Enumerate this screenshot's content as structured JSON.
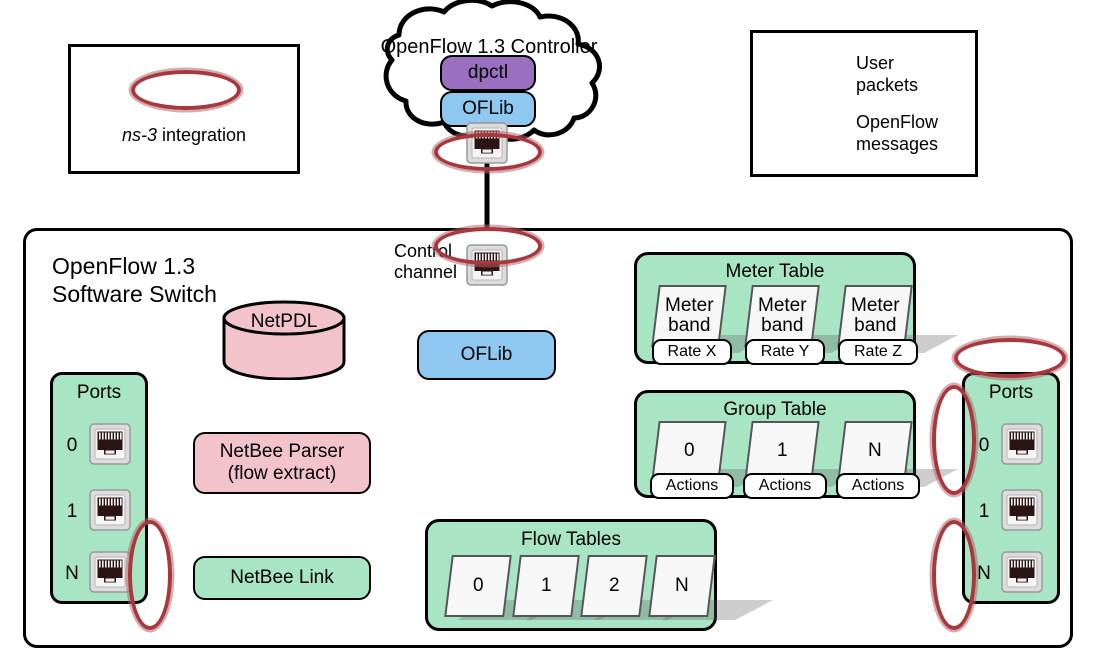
{
  "diagram": {
    "title": "OpenFlow 1.3 Software Switch architecture with ns-3 integration"
  },
  "legend_ns3": {
    "icon": "red-ellipse-icon",
    "label_italic": "ns-3",
    "label_rest": " integration"
  },
  "legend_arrows": {
    "rows": [
      {
        "icon": "dashed-arrow-icon",
        "label": "User\npackets"
      },
      {
        "icon": "solid-arrow-icon",
        "label": "OpenFlow\nmessages"
      }
    ]
  },
  "controller": {
    "cloud_title": "OpenFlow 1.3 Controller",
    "dpctl_label": "dpctl",
    "oflib_label": "OFLib",
    "jack_icon": "rj45-jack-icon"
  },
  "switch": {
    "title": "OpenFlow 1.3\nSoftware Switch",
    "control_channel_label": "Control\nchannel",
    "control_jack_icon": "rj45-jack-icon",
    "oflib_label": "OFLib",
    "netpdl_label": "NetPDL",
    "netbee_parser_label": "NetBee Parser\n(flow extract)",
    "netbee_link_label": "NetBee Link"
  },
  "ports_left": {
    "title": "Ports",
    "items": [
      {
        "num": "0",
        "icon": "rj45-jack-icon"
      },
      {
        "num": "1",
        "icon": "rj45-jack-icon"
      },
      {
        "num": "N",
        "icon": "rj45-jack-icon"
      }
    ]
  },
  "ports_right": {
    "title": "Ports",
    "items": [
      {
        "num": "0",
        "icon": "rj45-jack-icon"
      },
      {
        "num": "1",
        "icon": "rj45-jack-icon"
      },
      {
        "num": "N",
        "icon": "rj45-jack-icon"
      }
    ]
  },
  "meter_table": {
    "title": "Meter Table",
    "entries": [
      {
        "card": "Meter\nband",
        "pill": "Rate X"
      },
      {
        "card": "Meter\nband",
        "pill": "Rate Y"
      },
      {
        "card": "Meter\nband",
        "pill": "Rate Z"
      }
    ]
  },
  "group_table": {
    "title": "Group Table",
    "entries": [
      {
        "card": "0",
        "pill": "Actions"
      },
      {
        "card": "1",
        "pill": "Actions"
      },
      {
        "card": "N",
        "pill": "Actions"
      }
    ]
  },
  "flow_tables": {
    "title": "Flow Tables",
    "entries": [
      {
        "card": "0"
      },
      {
        "card": "1"
      },
      {
        "card": "2"
      },
      {
        "card": "N"
      }
    ]
  },
  "colors": {
    "green": "#a8e5c4",
    "pink": "#f3c3cc",
    "blue": "#8ec7ef",
    "purple": "#9a6fc0",
    "ns3_red": "#a8373e",
    "card": "#f7f7f7",
    "line": "#000000"
  }
}
